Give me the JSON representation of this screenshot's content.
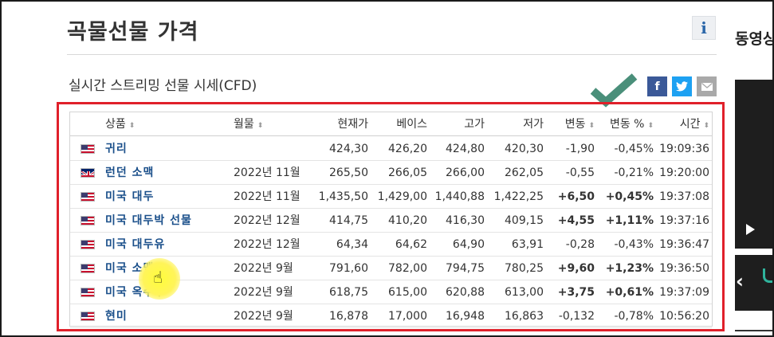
{
  "page": {
    "title": "곡물선물 가격",
    "info_icon_label": "i",
    "subtitle": "실시간 스트리밍 선물 시세(CFD)"
  },
  "share": {
    "facebook_label": "f",
    "twitter_icon": "twitter-bird",
    "email_icon": "envelope"
  },
  "table": {
    "headers": {
      "product": "상품",
      "month": "월물",
      "current": "현재가",
      "base": "베이스",
      "high": "고가",
      "low": "저가",
      "change": "변동",
      "change_pct": "변동 %",
      "time": "시간"
    },
    "sort_glyph": "⬍",
    "rows": [
      {
        "flag": "us",
        "name": "귀리",
        "month": "",
        "current": "424,30",
        "base": "426,20",
        "high": "424,80",
        "low": "420,30",
        "change": "-1,90",
        "change_pct": "-0,45%",
        "time": "19:09:36",
        "direction": "down"
      },
      {
        "flag": "uk",
        "name": "런던 소맥",
        "month": "2022년 11월",
        "current": "265,50",
        "base": "266,05",
        "high": "266,00",
        "low": "262,05",
        "change": "-0,55",
        "change_pct": "-0,21%",
        "time": "19:20:00",
        "direction": "down"
      },
      {
        "flag": "us",
        "name": "미국 대두",
        "month": "2022년 11월",
        "current": "1,435,50",
        "base": "1,429,00",
        "high": "1,440,88",
        "low": "1,422,25",
        "change": "+6,50",
        "change_pct": "+0,45%",
        "time": "19:37:08",
        "direction": "up"
      },
      {
        "flag": "us",
        "name": "미국 대두박 선물",
        "month": "2022년 12월",
        "current": "414,75",
        "base": "410,20",
        "high": "416,30",
        "low": "409,15",
        "change": "+4,55",
        "change_pct": "+1,11%",
        "time": "19:37:16",
        "direction": "up"
      },
      {
        "flag": "us",
        "name": "미국 대두유",
        "month": "2022년 12월",
        "current": "64,34",
        "base": "64,62",
        "high": "64,90",
        "low": "63,91",
        "change": "-0,28",
        "change_pct": "-0,43%",
        "time": "19:36:47",
        "direction": "down"
      },
      {
        "flag": "us",
        "name": "미국 소맥",
        "month": "2022년 9월",
        "current": "791,60",
        "base": "782,00",
        "high": "794,75",
        "low": "780,25",
        "change": "+9,60",
        "change_pct": "+1,23%",
        "time": "19:36:50",
        "direction": "up"
      },
      {
        "flag": "us",
        "name": "미국 옥수수",
        "month": "2022년 9월",
        "current": "618,75",
        "base": "615,00",
        "high": "620,88",
        "low": "613,00",
        "change": "+3,75",
        "change_pct": "+0,61%",
        "time": "19:37:09",
        "direction": "up"
      },
      {
        "flag": "us",
        "name": "현미",
        "month": "2022년 9월",
        "current": "16,878",
        "base": "17,000",
        "high": "16,948",
        "low": "16,863",
        "change": "-0,132",
        "change_pct": "-0,78%",
        "time": "10:56:20",
        "direction": "down"
      }
    ]
  },
  "sidebar": {
    "heading": "동영상"
  },
  "colors": {
    "up": "#c1121f",
    "down": "#1d8fb3",
    "name": "#1a4f8a",
    "highlight_border": "#e0202a",
    "checkmark": "#4a8f7a"
  }
}
